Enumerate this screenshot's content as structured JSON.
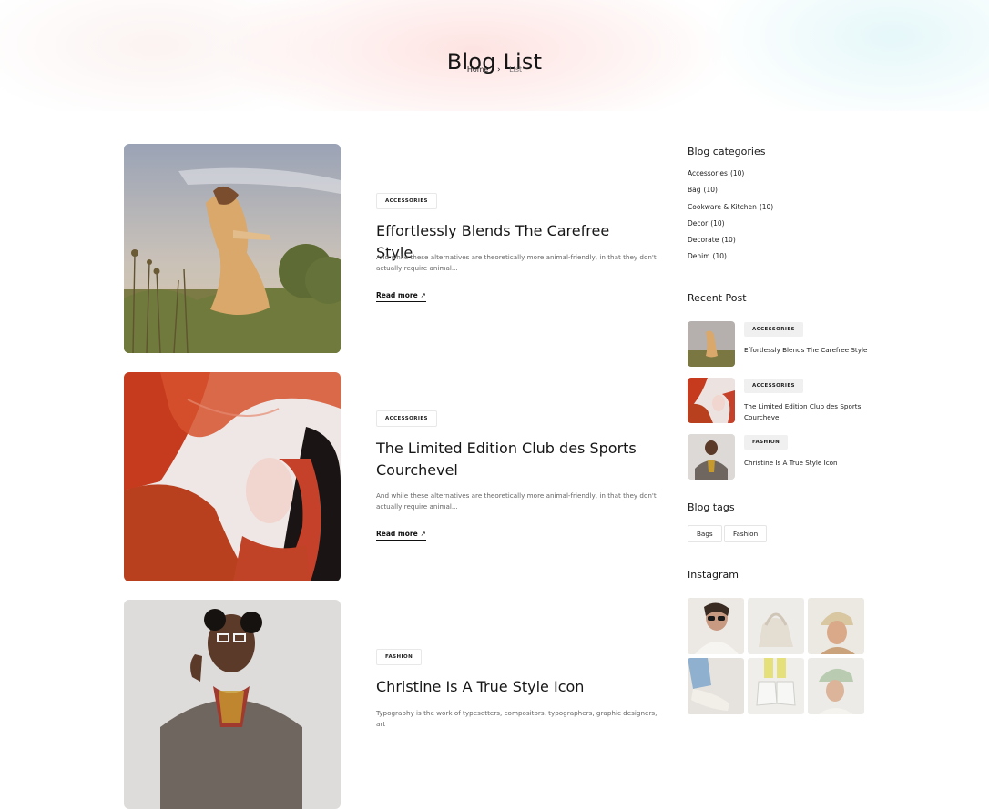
{
  "header": {
    "title": "Blog List",
    "breadcrumb": {
      "home": "Home",
      "separator": "›",
      "current": "List"
    }
  },
  "posts": [
    {
      "category": "ACCESSORIES",
      "title": "Effortlessly Blends The Carefree Style",
      "excerpt": "And while these alternatives are theoretically more animal-friendly, in that they don't actually require animal...",
      "read_more": "Read more",
      "read_more_icon": "↗"
    },
    {
      "category": "ACCESSORIES",
      "title": "The Limited Edition Club des Sports Courchevel",
      "excerpt": "And while these alternatives are theoretically more animal-friendly, in that they don't actually require animal...",
      "read_more": "Read more",
      "read_more_icon": "↗"
    },
    {
      "category": "FASHION",
      "title": "Christine Is A True Style Icon",
      "excerpt": "Typography is the work of typesetters, compositors, typographers, graphic designers, art"
    }
  ],
  "sidebar": {
    "categories_title": "Blog categories",
    "categories": [
      {
        "name": "Accessories",
        "count": "(10)"
      },
      {
        "name": "Bag",
        "count": "(10)"
      },
      {
        "name": "Cookware & Kitchen",
        "count": "(10)"
      },
      {
        "name": "Decor",
        "count": "(10)"
      },
      {
        "name": "Decorate",
        "count": "(10)"
      },
      {
        "name": "Denim",
        "count": "(10)"
      }
    ],
    "recent_title": "Recent Post",
    "recent": [
      {
        "category": "ACCESSORIES",
        "title": "Effortlessly Blends The Carefree Style"
      },
      {
        "category": "ACCESSORIES",
        "title": "The Limited Edition Club des Sports Courchevel"
      },
      {
        "category": "FASHION",
        "title": "Christine Is A True Style Icon"
      }
    ],
    "tags_title": "Blog tags",
    "tags": [
      "Bags",
      "Fashion"
    ],
    "instagram_title": "Instagram"
  }
}
